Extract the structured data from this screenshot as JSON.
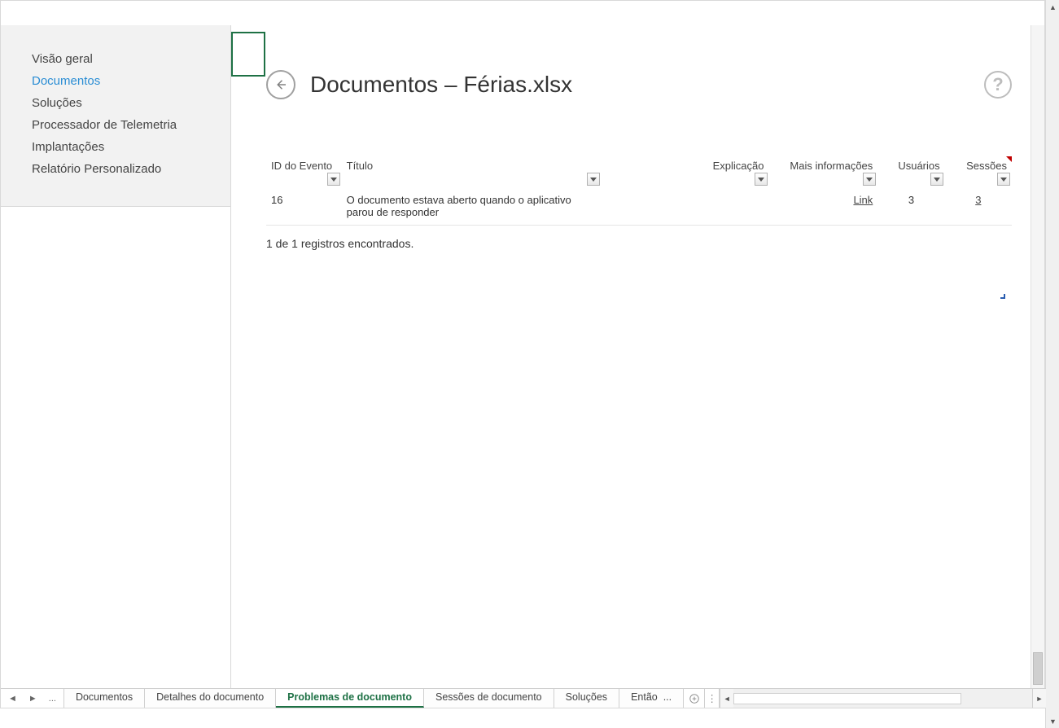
{
  "sidebar": {
    "items": [
      {
        "label": "Visão geral"
      },
      {
        "label": "Documentos"
      },
      {
        "label": "Soluções"
      },
      {
        "label": "Processador de Telemetria"
      },
      {
        "label": "Implantações"
      },
      {
        "label": "Relatório Personalizado"
      }
    ],
    "active_index": 1
  },
  "header": {
    "title": "Documentos – Férias.xlsx"
  },
  "table": {
    "columns": [
      {
        "label": "ID do Evento"
      },
      {
        "label": "Título"
      },
      {
        "label": "Explicação"
      },
      {
        "label": "Mais informações"
      },
      {
        "label": "Usuários"
      },
      {
        "label": "Sessões"
      }
    ],
    "rows": [
      {
        "event_id": "16",
        "title": "O documento estava aberto quando o aplicativo parou de responder",
        "explanation": "",
        "more_info": "Link",
        "users": "3",
        "sessions": "3"
      }
    ]
  },
  "records_info": "1 de 1 registros encontrados.",
  "sheet_tabs": {
    "items": [
      {
        "label": "Documentos"
      },
      {
        "label": "Detalhes do documento"
      },
      {
        "label": "Problemas de documento"
      },
      {
        "label": "Sessões de documento"
      },
      {
        "label": "Soluções"
      },
      {
        "label": "Então"
      }
    ],
    "ellipsis": "...",
    "active_index": 2
  }
}
